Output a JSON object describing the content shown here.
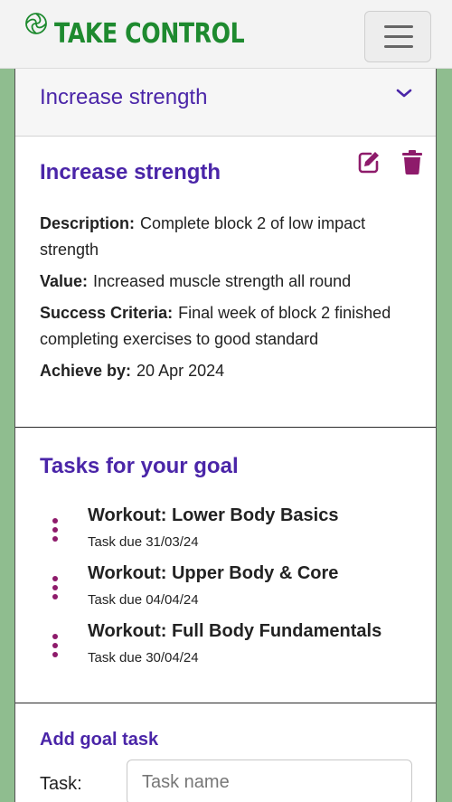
{
  "header": {
    "brand_name": "TAKE CONTROL",
    "brand_color": "#1e8a2f",
    "logo_icon": "swirl-logo-icon",
    "menu_icon": "hamburger-menu-icon"
  },
  "goal": {
    "accordion_title": "Increase strength",
    "title": "Increase strength",
    "actions": {
      "edit_icon": "edit-icon",
      "delete_icon": "trash-icon"
    },
    "description_label": "Description:",
    "description": "Complete block 2 of low impact strength",
    "value_label": "Value:",
    "value": "Increased muscle strength all round",
    "success_label": "Success Criteria:",
    "success": "Final week of block 2 finished completing exercises to good standard",
    "achieve_label": "Achieve by:",
    "achieve_by": "20 Apr 2024"
  },
  "tasks": {
    "heading": "Tasks for your goal",
    "items": [
      {
        "name": "Workout: Lower Body Basics",
        "due": "Task due 31/03/24"
      },
      {
        "name": "Workout: Upper Body & Core",
        "due": "Task due 04/04/24"
      },
      {
        "name": "Workout: Full Body Fundamentals",
        "due": "Task due 30/04/24"
      }
    ]
  },
  "add_task": {
    "heading": "Add goal task",
    "task_label": "Task:",
    "task_placeholder": "Task name",
    "task_value": ""
  },
  "colors": {
    "accent_purple": "#4a25a8",
    "icon_magenta": "#8e1b6b",
    "side_green": "#8fbd8f"
  }
}
